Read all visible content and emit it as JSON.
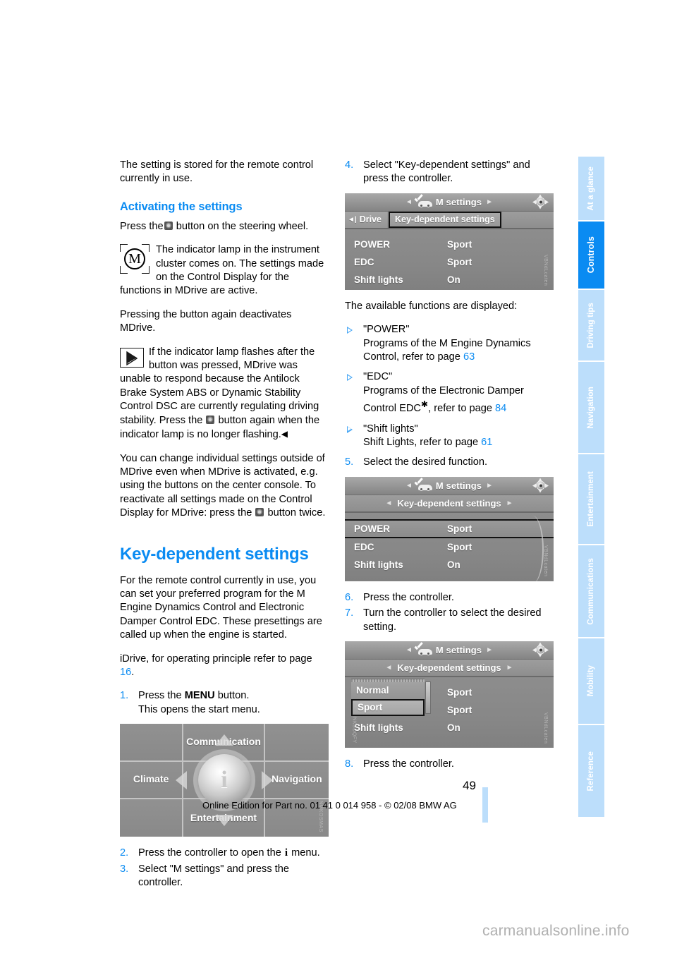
{
  "document": {
    "page_number": "49",
    "footer_line": "Online Edition for Part no. 01 41 0 014 958 - © 02/08 BMW AG",
    "brand_watermark": "carmanualsonline.info",
    "accent_color": "#0a8bf2",
    "tab_color": "#bcdefb"
  },
  "sidebar": {
    "tabs": [
      {
        "label": "At a glance",
        "active": false
      },
      {
        "label": "Controls",
        "active": true
      },
      {
        "label": "Driving tips",
        "active": false
      },
      {
        "label": "Navigation",
        "active": false
      },
      {
        "label": "Entertainment",
        "active": false
      },
      {
        "label": "Communications",
        "active": false
      },
      {
        "label": "Mobility",
        "active": false
      },
      {
        "label": "Reference",
        "active": false
      }
    ]
  },
  "left_column": {
    "intro_paragraph": "The setting is stored for the remote control currently in use.",
    "activating_heading": "Activating the settings",
    "press_button_pre": "Press the",
    "press_button_post": "button on the steering wheel.",
    "lamp_note": "The indicator lamp in the instrument cluster comes on. The settings made on the Control Display for the functions in MDrive are active.",
    "deactivate_line": "Pressing the button again deactivates MDrive.",
    "flash_note_part1": "If the indicator lamp flashes after the button was pressed, MDrive was unable to respond because the Antilock Brake System ABS or Dynamic Stability Control DSC are currently regulating driving stability. Press the",
    "flash_note_part2": "button again when the indicator lamp is no longer flashing.",
    "individual_settings_part1": "You can change individual settings outside of MDrive even when MDrive is activated, e.g. using the buttons on the center console. To reactivate all settings made on the Control Display for MDrive: press the",
    "individual_settings_part2": "button twice.",
    "chapter_heading": "Key-dependent settings",
    "chapter_paragraph": "For the remote control currently in use, you can set your preferred program for the M Engine Dynamics Control and Electronic Damper Control EDC. These presettings are called up when the engine is started.",
    "idrive_line_pre": "iDrive, for operating principle refer to page",
    "idrive_page": "16",
    "steps": [
      {
        "num": "1.",
        "text_pre": "Press the ",
        "bold": "MENU",
        "text_post": " button.",
        "subline": "This opens the start menu."
      },
      {
        "num": "2.",
        "text_pre": "Press the controller to open the ",
        "glyph": "i",
        "text_post": " menu."
      },
      {
        "num": "3.",
        "text_pre": "Select \"M settings\" and press the controller.",
        "bold": "",
        "text_post": ""
      }
    ]
  },
  "start_menu": {
    "cells": [
      "",
      "Communication",
      "",
      "Climate",
      "",
      "Navigation",
      "",
      "Entertainment",
      ""
    ],
    "center_icon": "i",
    "watermark": "NMKOSMAS"
  },
  "right_column": {
    "step4": {
      "num": "4.",
      "text": "Select \"Key-dependent settings\" and press the controller."
    },
    "available_line": "The available functions are displayed:",
    "functions": [
      {
        "title": "\"POWER\"",
        "desc_pre": "Programs of the M Engine Dynamics Control, refer to page",
        "page": "63",
        "star": false
      },
      {
        "title": "\"EDC\"",
        "desc_pre": "Programs of the Electronic Damper Control EDC",
        "desc_post": ", refer to page",
        "page": "84",
        "star": true
      },
      {
        "title": "\"Shift lights\"",
        "desc_pre": "Shift Lights, refer to page",
        "page": "61",
        "star": false
      }
    ],
    "step5": {
      "num": "5.",
      "text": "Select the desired function."
    },
    "step6": {
      "num": "6.",
      "text": "Press the controller."
    },
    "step7": {
      "num": "7.",
      "text": "Turn the controller to select the desired setting."
    },
    "step8": {
      "num": "8.",
      "text": "Press the controller."
    }
  },
  "screens": {
    "screen1": {
      "title": "M settings",
      "back_tab": "Drive",
      "selected_tab": "Key-dependent settings",
      "rows": [
        {
          "label": "POWER",
          "value": "Sport",
          "selected": false
        },
        {
          "label": "EDC",
          "value": "Sport",
          "selected": false
        },
        {
          "label": "Shift lights",
          "value": "On",
          "selected": false
        }
      ],
      "watermark": "VBNdLcaten"
    },
    "screen2": {
      "title": "M settings",
      "subtitle": "Key-dependent settings",
      "rows": [
        {
          "label": "POWER",
          "value": "Sport",
          "selected": true
        },
        {
          "label": "EDC",
          "value": "Sport",
          "selected": false
        },
        {
          "label": "Shift lights",
          "value": "On",
          "selected": false
        }
      ],
      "watermark": "VBNdLcaten"
    },
    "screen3": {
      "title": "M settings",
      "subtitle": "Key-dependent settings",
      "popup_options": [
        {
          "label": "Normal",
          "active": false
        },
        {
          "label": "Sport",
          "active": true
        }
      ],
      "rows": [
        {
          "label": "",
          "value": "Sport",
          "selected": false
        },
        {
          "label": "",
          "value": "Sport",
          "selected": false
        },
        {
          "label": "Shift lights",
          "value": "On",
          "selected": false
        }
      ],
      "watermark_left": "MNKSDQFY",
      "watermark": "VBNdLcaten"
    }
  }
}
